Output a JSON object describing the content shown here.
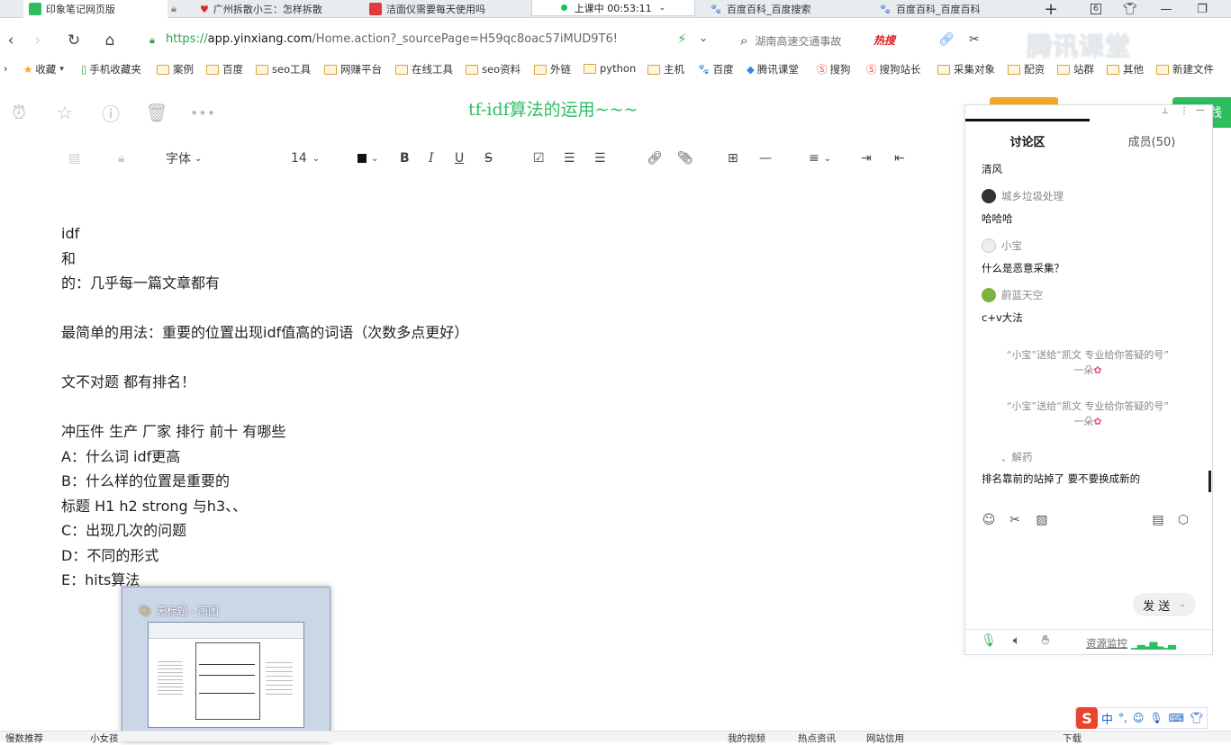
{
  "tabs": [
    {
      "label": "印象笔记网页版",
      "color": "#2dbe60"
    },
    {
      "label": "广州拆散小三：怎样拆散",
      "color": "#e02424"
    },
    {
      "label": "洁面仪需要每天使用吗",
      "color": "#e23b3b"
    },
    {
      "label": "百度百科_百度搜索",
      "color": "#3a7bd5"
    },
    {
      "label": "百度百科_百度百科",
      "color": "#3a7bd5"
    }
  ],
  "tab_count": "6",
  "live": {
    "text": "上课中 00:53:11"
  },
  "url": {
    "scheme": "https://",
    "host": "app.yinxiang.com",
    "path": "/Home.action?_sourcePage=H59qc8oac57iMUD9T6!"
  },
  "search": {
    "placeholder": "湖南高速交通事故"
  },
  "hot": "热搜",
  "bookmarks": [
    "收藏",
    "手机收藏夹",
    "案例",
    "百度",
    "seo工具",
    "网赚平台",
    "在线工具",
    "seo资料",
    "外链",
    "python",
    "主机",
    "百度",
    "腾讯课堂",
    "搜狗",
    "搜狗站长",
    "采集对象",
    "配资",
    "站群",
    "其他",
    "新建文件"
  ],
  "note": {
    "title": "tf-idf算法的运用~~~",
    "font_label": "字体",
    "font_size": "14",
    "lines": [
      "idf",
      "和",
      "的：几乎每一篇文章都有",
      "",
      "最简单的用法：重要的位置出现idf值高的词语（次数多点更好）",
      "",
      "文不对题 都有排名！",
      "",
      "冲压件   生产    厂家    排行    前十    有哪些",
      "A：什么词 idf更高",
      "B：什么样的位置是重要的",
      "标题 H1 h2 strong 与h3、、",
      "C：出现几次的问题",
      "D：不同的形式",
      "E：hits算法"
    ]
  },
  "panel": {
    "tab_discussion": "讨论区",
    "tab_members": "成员(50)",
    "messages": [
      {
        "type": "text",
        "text": "清风"
      },
      {
        "type": "user",
        "name": "城乡垃圾处理",
        "color": "#333"
      },
      {
        "type": "text",
        "text": "哈哈哈"
      },
      {
        "type": "user",
        "name": "小宝",
        "color": "#ddd"
      },
      {
        "type": "text",
        "text": "什么是恶意采集？"
      },
      {
        "type": "user",
        "name": "蔚蓝天空",
        "color": "#7cb342"
      },
      {
        "type": "text",
        "text": "c+v大法"
      },
      {
        "type": "gift",
        "line1": "“小宝”送给“凯文 专业给你答疑的号”",
        "line2": "一朵"
      },
      {
        "type": "gift",
        "line1": "“小宝”送给“凯文 专业给你答疑的号”",
        "line2": "一朵"
      },
      {
        "type": "user",
        "name": "、解药",
        "color": "#fff"
      },
      {
        "type": "text",
        "text": "排名靠前的站掉了   要不要换成新的"
      }
    ],
    "send_label": "发 送",
    "resource_label": "资源监控"
  },
  "overlay": {
    "brand": "腾讯课堂",
    "right_btn": "践"
  },
  "thumbnail": {
    "title": "无标题 - 画图"
  },
  "taskbar": [
    "慢数推荐",
    "小女孩",
    "我的视频",
    "热点资讯",
    "网站信用",
    "下载"
  ],
  "ime": {
    "logo": "S",
    "lang": "中"
  }
}
